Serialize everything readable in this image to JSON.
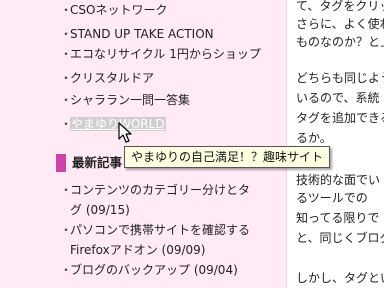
{
  "sidebar": {
    "links": [
      {
        "label": "CSOネットワーク"
      },
      {
        "label": "STAND UP TAKE ACTION"
      },
      {
        "label": "エコなリサイクル 1円からショップ"
      },
      {
        "label": "クリスタルドア"
      },
      {
        "label": "シャララン一問一答集"
      },
      {
        "label": "やまゆりWORLD"
      }
    ],
    "recent_heading": "最新記事",
    "recent_posts": [
      {
        "title_line1": "コンテンツのカテゴリー分けとタ",
        "title_line2": "グ (09/15)"
      },
      {
        "title_line1": "パソコンで携帯サイトを確認する",
        "title_line2": "Firefoxアドオン (09/09)"
      },
      {
        "title_line1": "ブログのバックアップ (09/04)",
        "title_line2": ""
      }
    ]
  },
  "tooltip": {
    "text": "やまゆりの自己満足！？趣味サイト"
  },
  "main": {
    "lines": [
      "て、タグをクリッ",
      "さらに、よく使わ",
      "ものなのか？と上",
      "",
      "どちらも同じよう",
      "いるので、系統",
      "タグを追加できる",
      "るか。",
      "",
      "技術的な面でい",
      "るツールでの",
      "知ってる限りで",
      "と、同じくブログ",
      "",
      "しかし、タグとい"
    ]
  }
}
